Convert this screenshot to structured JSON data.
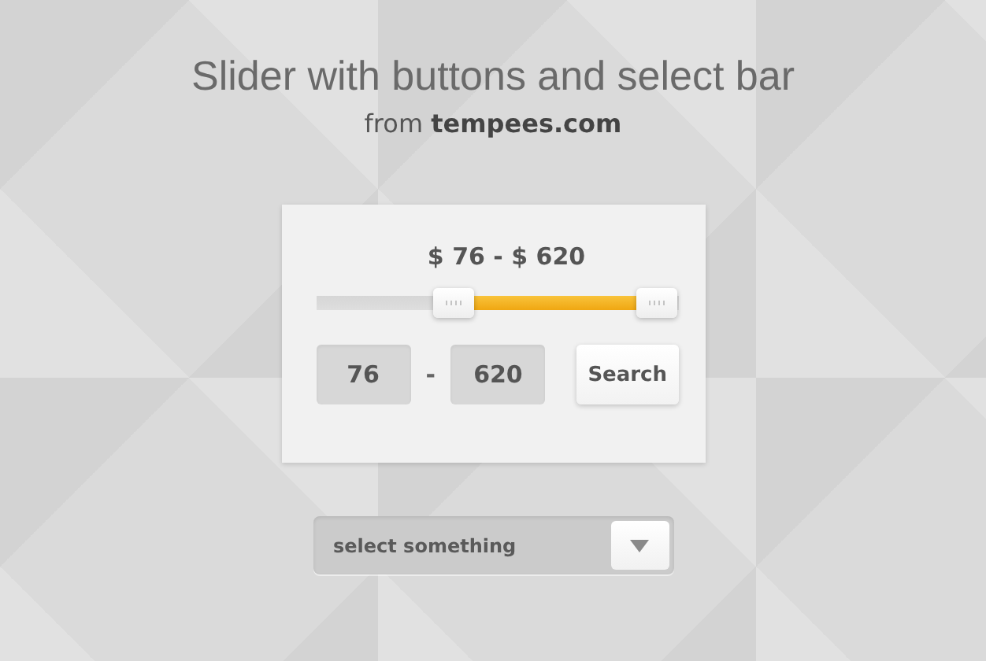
{
  "header": {
    "title": "Slider with buttons and select bar",
    "subtitle": "from **tempees.com**"
  },
  "price_filter": {
    "range_label": "$ 76 - $ 620",
    "slider": {
      "thumbs": [
        {
          "level": 0.38
        },
        {
          "level": 0.94
        }
      ]
    },
    "min_field": {
      "value": "76"
    },
    "separator": "-",
    "max_field": {
      "value": "620"
    },
    "search_button": "Search"
  },
  "select": {
    "placeholder": "select something"
  }
}
